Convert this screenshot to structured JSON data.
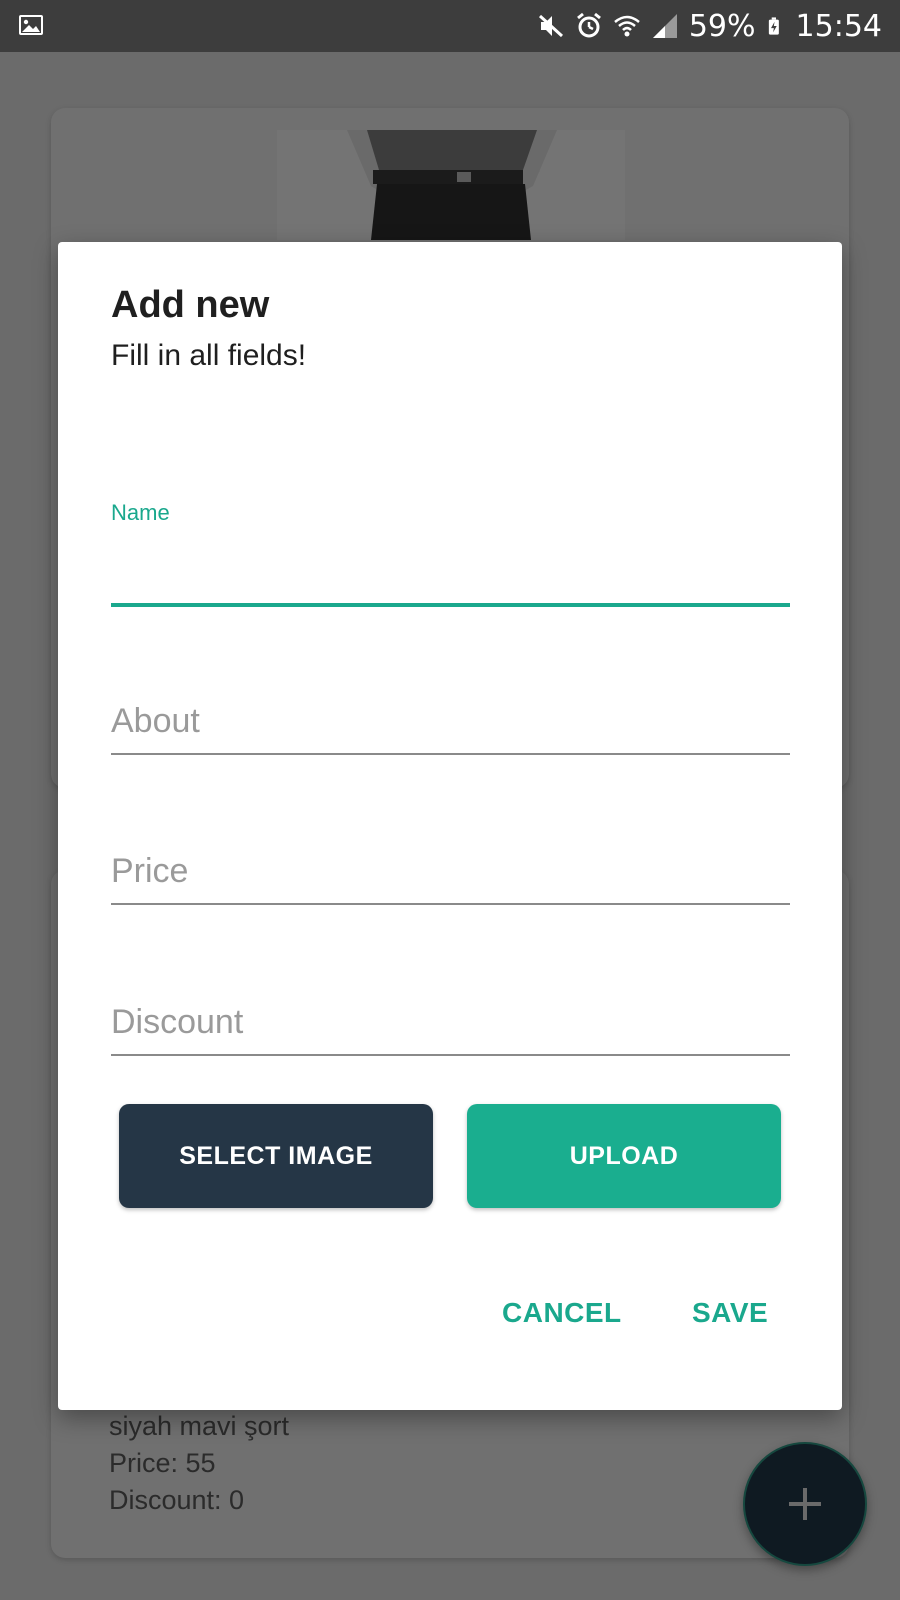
{
  "status_bar": {
    "battery": "59%",
    "time": "15:54",
    "icons": [
      "gallery-icon",
      "mute-icon",
      "alarm-icon",
      "wifi-icon",
      "signal-icon",
      "battery-icon"
    ]
  },
  "background_list": {
    "item": {
      "name": "siyah mavi şort",
      "price": "Price: 55",
      "discount": "Discount: 0"
    }
  },
  "dialog": {
    "title": "Add new",
    "subtitle": "Fill in all fields!",
    "fields": {
      "name": {
        "label": "Name",
        "value": ""
      },
      "about": {
        "placeholder": "About"
      },
      "price": {
        "placeholder": "Price"
      },
      "discount": {
        "placeholder": "Discount"
      }
    },
    "buttons": {
      "select_image": "SELECT IMAGE",
      "upload": "UPLOAD"
    },
    "actions": {
      "cancel": "CANCEL",
      "save": "SAVE"
    }
  },
  "fab": {
    "icon": "plus-icon"
  },
  "colors": {
    "accent": "#1aa88d",
    "dark_button": "#253646",
    "upload_button": "#1aae8f",
    "status_bar": "#3d3d3d",
    "scrim": "#6b6b6b"
  }
}
